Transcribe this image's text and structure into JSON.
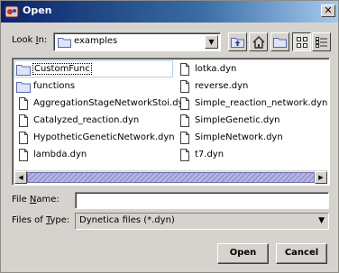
{
  "window": {
    "title": "Open",
    "close_glyph": "✕",
    "icon": "dynetica-app-icon"
  },
  "lookin": {
    "label_prefix": "Look ",
    "label_accel": "I",
    "label_suffix": "n:",
    "value": "examples",
    "icons": [
      "up-folder-icon",
      "home-icon",
      "new-folder-icon",
      "list-view-icon",
      "details-view-icon"
    ]
  },
  "files": {
    "column1": [
      {
        "name": "CustomFunc",
        "type": "folder"
      },
      {
        "name": "functions",
        "type": "folder"
      },
      {
        "name": "AggregationStageNetworkStoi.dyn",
        "type": "file"
      },
      {
        "name": "Catalyzed_reaction.dyn",
        "type": "file"
      },
      {
        "name": "HypotheticGeneticNetwork.dyn",
        "type": "file"
      },
      {
        "name": "lambda.dyn",
        "type": "file"
      }
    ],
    "column2": [
      {
        "name": "lotka.dyn",
        "type": "file"
      },
      {
        "name": "reverse.dyn",
        "type": "file"
      },
      {
        "name": "Simple_reaction_network.dyn",
        "type": "file"
      },
      {
        "name": "SimpleGenetic.dyn",
        "type": "file"
      },
      {
        "name": "SimpleNetwork.dyn",
        "type": "file"
      },
      {
        "name": "t7.dyn",
        "type": "file"
      }
    ],
    "selected": "CustomFunc"
  },
  "filename": {
    "label_prefix": "File ",
    "label_accel": "N",
    "label_suffix": "ame:",
    "value": ""
  },
  "filetype": {
    "label_prefix": "Files of ",
    "label_accel": "T",
    "label_suffix": "ype:",
    "value": "Dynetica files (*.dyn)"
  },
  "buttons": {
    "open": "Open",
    "cancel": "Cancel"
  },
  "colors": {
    "titlebar_start": "#0a246a",
    "titlebar_end": "#a6caf0",
    "window_bg": "#d6d3ce",
    "scroll_thumb": "#9a9ad2"
  }
}
